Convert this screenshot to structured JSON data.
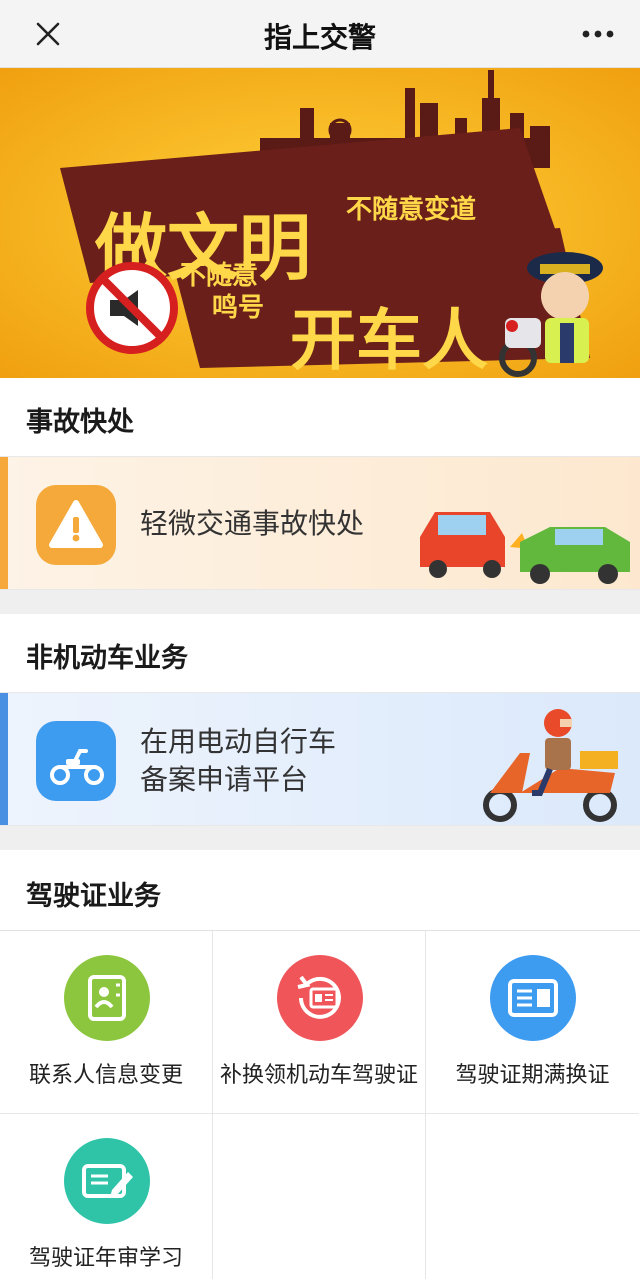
{
  "window": {
    "title": "指上交警"
  },
  "topbar": {
    "close_icon": "close-icon",
    "more_icon": "more-dots-icon"
  },
  "banner": {
    "headline_top": "做文明",
    "headline_bottom": "开车人",
    "slogan_1": "不随意变道",
    "slogan_2_line1": "不随意",
    "slogan_2_line2": "鸣号",
    "colors": {
      "bg": "#f5b820",
      "ribbon": "#6b1f1a",
      "text": "#ffd84a"
    }
  },
  "sections": {
    "accident": {
      "title": "事故快处"
    },
    "nonmotor": {
      "title": "非机动车业务"
    },
    "license": {
      "title": "驾驶证业务"
    }
  },
  "cards": {
    "accident": {
      "label": "轻微交通事故快处",
      "icon": "warning-icon",
      "accent": "#f6a93a"
    },
    "ebike": {
      "line1": "在用电动自行车",
      "line2": "备案申请平台",
      "icon": "scooter-icon",
      "accent": "#4a90e2"
    }
  },
  "license_items": [
    {
      "label": "联系人信息变更",
      "icon": "contact-book-icon",
      "color": "#8cc63f"
    },
    {
      "label": "补换领机动车驾驶证",
      "icon": "renew-card-icon",
      "color": "#f0555a"
    },
    {
      "label": "驾驶证期满换证",
      "icon": "id-card-icon",
      "color": "#3d9bf0"
    },
    {
      "label": "驾驶证年审学习",
      "icon": "note-pen-icon",
      "color": "#2fc4a8"
    }
  ]
}
